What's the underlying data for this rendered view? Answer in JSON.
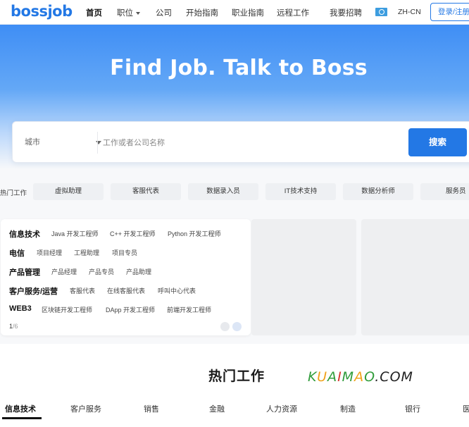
{
  "header": {
    "logo": "bossjob",
    "nav": [
      {
        "label": "首页",
        "active": true
      },
      {
        "label": "职位",
        "has_dropdown": true
      },
      {
        "label": "公司"
      },
      {
        "label": "开始指南"
      },
      {
        "label": "职业指南"
      },
      {
        "label": "远程工作"
      },
      {
        "label": "我要招聘"
      }
    ],
    "language": "ZH-CN",
    "login_label": "登录/注册"
  },
  "hero": {
    "title": "Find Job. Talk to Boss"
  },
  "search": {
    "city_label": "城市",
    "input_placeholder": "工作或者公司名称",
    "input_value": "",
    "button_label": "搜索"
  },
  "hot_jobs": {
    "label": "热门工作",
    "tags": [
      "虚拟助理",
      "客服代表",
      "数据录入员",
      "IT技术支持",
      "数据分析师",
      "服务员"
    ]
  },
  "categories": {
    "rows": [
      {
        "name": "信息技术",
        "jobs": [
          "Java 开发工程师",
          "C++ 开发工程师",
          "Python 开发工程师"
        ]
      },
      {
        "name": "电信",
        "jobs": [
          "项目经理",
          "工程助理",
          "项目专员"
        ]
      },
      {
        "name": "产品管理",
        "jobs": [
          "产品经理",
          "产品专员",
          "产品助理"
        ]
      },
      {
        "name": "客户服务/运营",
        "jobs": [
          "客服代表",
          "在线客服代表",
          "呼叫中心代表"
        ]
      },
      {
        "name": "WEB3",
        "jobs": [
          "区块链开发工程师",
          "DApp 开发工程师",
          "前端开发工程师"
        ]
      }
    ],
    "page_current": "1",
    "page_total": "/6"
  },
  "hot_section": {
    "title": "热门工作",
    "watermark": "KUAIMAO.COM",
    "tabs": [
      {
        "label": "信息技术",
        "active": true
      },
      {
        "label": "客户服务"
      },
      {
        "label": "销售"
      },
      {
        "label": "金融"
      },
      {
        "label": "人力资源"
      },
      {
        "label": "制造"
      },
      {
        "label": "银行"
      },
      {
        "label": "医"
      }
    ]
  },
  "colors": {
    "brand": "#2378e5",
    "hero_top": "#3f8ef5"
  }
}
